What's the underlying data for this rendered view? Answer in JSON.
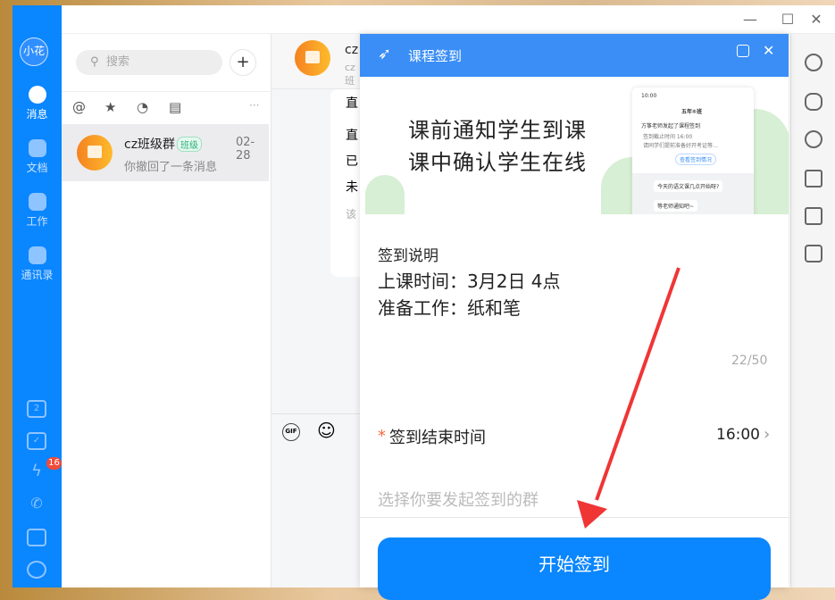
{
  "window": {
    "minimize": "—",
    "maximize": "☐",
    "close": "✕"
  },
  "sidebar": {
    "user": "小花",
    "items": [
      {
        "label": "消息"
      },
      {
        "label": "文档"
      },
      {
        "label": "工作"
      },
      {
        "label": "通讯录"
      }
    ],
    "calendar_day": "2",
    "badge": "16"
  },
  "list": {
    "search_placeholder": "搜索",
    "add": "+",
    "filters": {
      "at": "@",
      "star": "★",
      "recent": "◔",
      "archive": "▤",
      "more": "···"
    },
    "chats": [
      {
        "name": "cz班级群",
        "tag": "班级",
        "time": "02-28",
        "preview": "你撤回了一条消息"
      }
    ]
  },
  "chat": {
    "title": "cz",
    "subtitle": "cz班",
    "lines": [
      "直",
      "直",
      "已",
      "未",
      "该"
    ],
    "gif": "GIF",
    "emoji": "☺"
  },
  "modal": {
    "title": "课程签到",
    "banner": {
      "line1": "课前通知学生到课",
      "line2": "课中确认学生在线",
      "phone": {
        "time": "10:00",
        "group": "五年⑤班",
        "notice": "方筝老师发起了课程签到",
        "deadline": "签到截止时间 16:00",
        "desc": "请同学们提前准备好开考证等…",
        "view": "查看签到情况",
        "msg1": "今天的语文课几点开始呀?",
        "msg2": "等老师通知吧~"
      }
    },
    "desc_label": "签到说明",
    "desc_lines": [
      "上课时间：3月2日 4点",
      "准备工作：纸和笔"
    ],
    "counter": "22/50",
    "required": "*",
    "end_time_label": "签到结束时间",
    "end_time": "16:00",
    "group_placeholder": "选择你要发起签到的群",
    "start_button": "开始签到"
  },
  "colors": {
    "brand": "#0a86ff",
    "header": "#3a8ef6",
    "arrow": "#f03535"
  }
}
